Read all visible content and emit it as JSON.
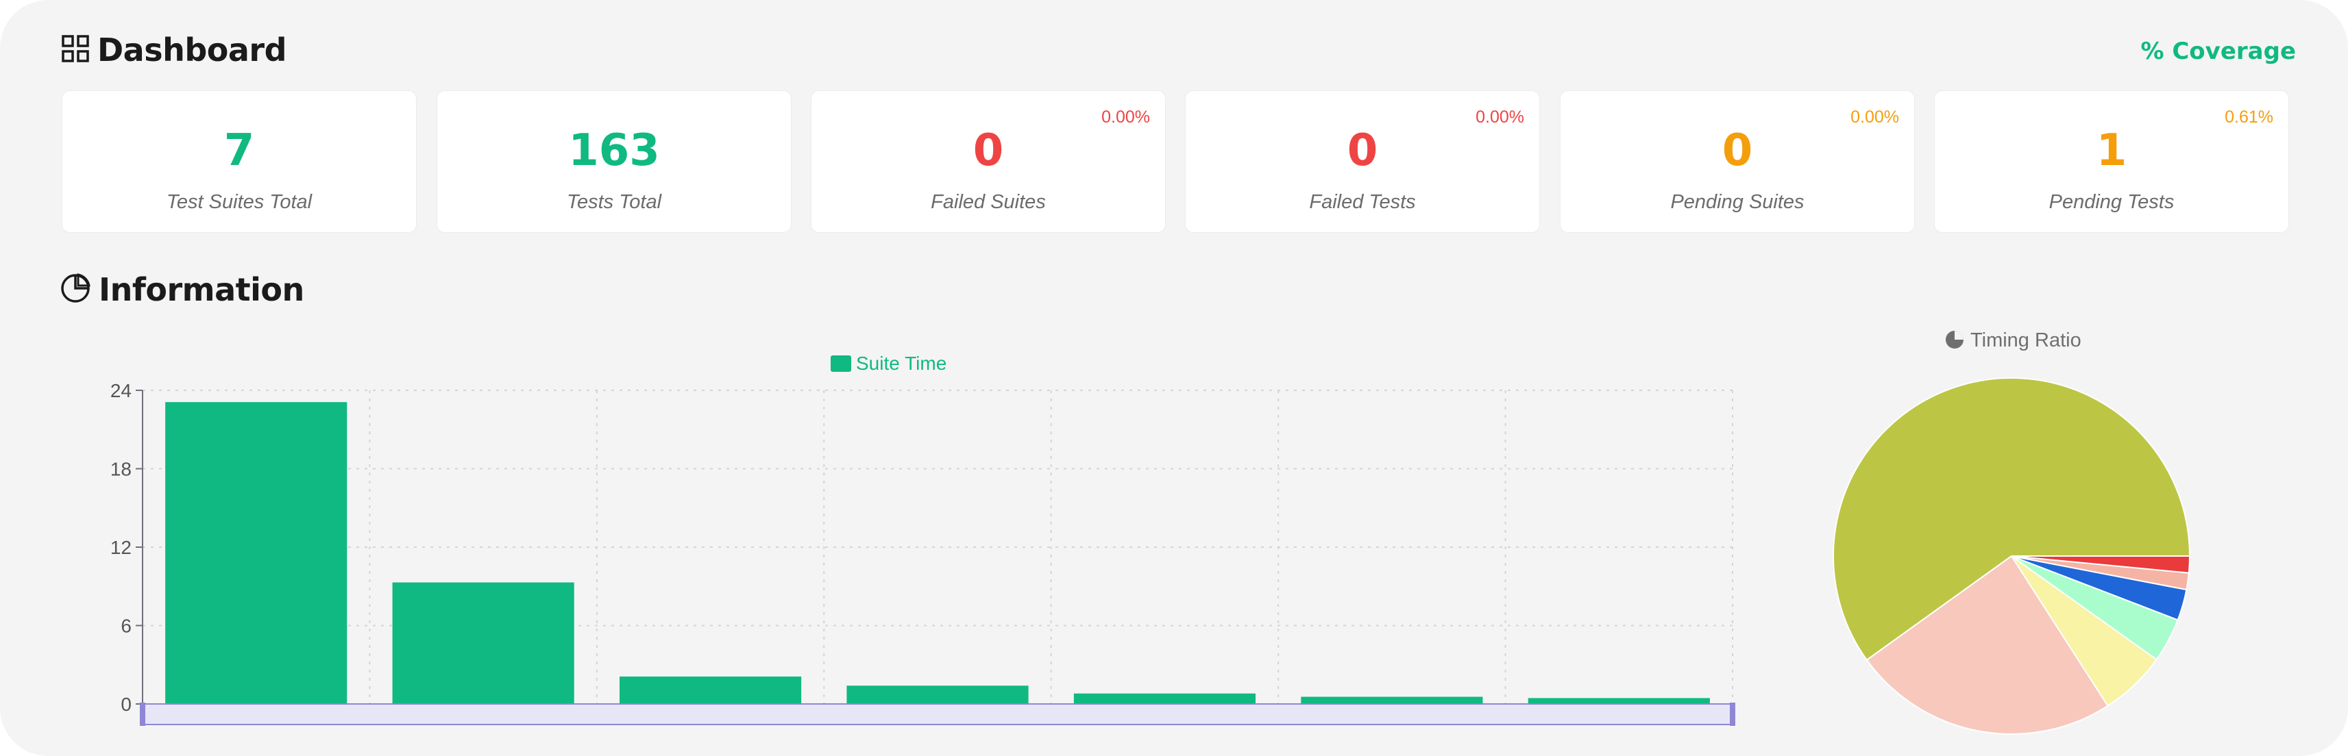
{
  "dashboard": {
    "title": "Dashboard",
    "coverage_link": "% Coverage",
    "cards": [
      {
        "value": "7",
        "label": "Test Suites Total",
        "percent": "",
        "color": "#10b981"
      },
      {
        "value": "163",
        "label": "Tests Total",
        "percent": "",
        "color": "#10b981"
      },
      {
        "value": "0",
        "label": "Failed Suites",
        "percent": "0.00%",
        "color": "#ef4444"
      },
      {
        "value": "0",
        "label": "Failed Tests",
        "percent": "0.00%",
        "color": "#ef4444"
      },
      {
        "value": "0",
        "label": "Pending Suites",
        "percent": "0.00%",
        "color": "#f59e0b"
      },
      {
        "value": "1",
        "label": "Pending Tests",
        "percent": "0.61%",
        "color": "#f59e0b"
      }
    ]
  },
  "information": {
    "title": "Information"
  },
  "chart_data": [
    {
      "type": "bar",
      "legend": "Suite Time",
      "legend_position": "top-center",
      "color": "#10b981",
      "values": [
        23.1,
        9.3,
        2.1,
        1.4,
        0.8,
        0.55,
        0.45
      ],
      "yticks": [
        "24",
        "18",
        "12",
        "6",
        "0"
      ],
      "ylim": [
        0,
        24
      ],
      "grid": true,
      "data_zoom_slider": true
    },
    {
      "type": "pie",
      "title": "Timing Ratio",
      "slices": [
        {
          "value": 59.5,
          "color": "#bcc644"
        },
        {
          "value": 24.0,
          "color": "#f8c8bd"
        },
        {
          "value": 6.0,
          "color": "#f8f3a5"
        },
        {
          "value": 4.0,
          "color": "#a9fdcd"
        },
        {
          "value": 2.8,
          "color": "#1f67d8"
        },
        {
          "value": 1.5,
          "color": "#f5b3a4"
        },
        {
          "value": 1.5,
          "color": "#e93b3b"
        }
      ]
    }
  ]
}
